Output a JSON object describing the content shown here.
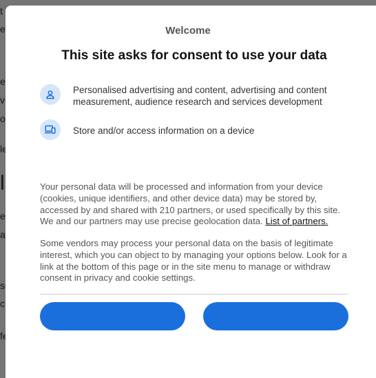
{
  "background_page": {
    "fragments": [
      "t",
      "e",
      "e",
      "v",
      "o",
      "le",
      "l",
      "e",
      "a",
      "se",
      "c",
      "fe"
    ]
  },
  "dialog": {
    "welcome": "Welcome",
    "headline": "This site asks for consent to use your data",
    "purposes": [
      {
        "icon": "person-icon",
        "text": "Personalised advertising and content, advertising and content measurement, audience research and services development"
      },
      {
        "icon": "devices-icon",
        "text": "Store and/or access information on a device"
      }
    ],
    "paragraph1_text": "Your personal data will be processed and information from your device (cookies, unique identifiers, and other device data) may be stored by, accessed by and shared with 210 partners, or used specifically by this site. We and our partners may use precise geolocation data.",
    "paragraph1_link": "List of partners.",
    "paragraph2_text": "Some vendors may process your personal data on the basis of legitimate interest, which you can object to by managing your options below. Look for a link at the bottom of this page or in the site menu to manage or withdraw consent in privacy and cookie settings.",
    "buttons": {
      "left_label": "",
      "right_label": ""
    },
    "colors": {
      "accent": "#1a6fdc",
      "icon_bg": "#d6e6f8"
    }
  }
}
